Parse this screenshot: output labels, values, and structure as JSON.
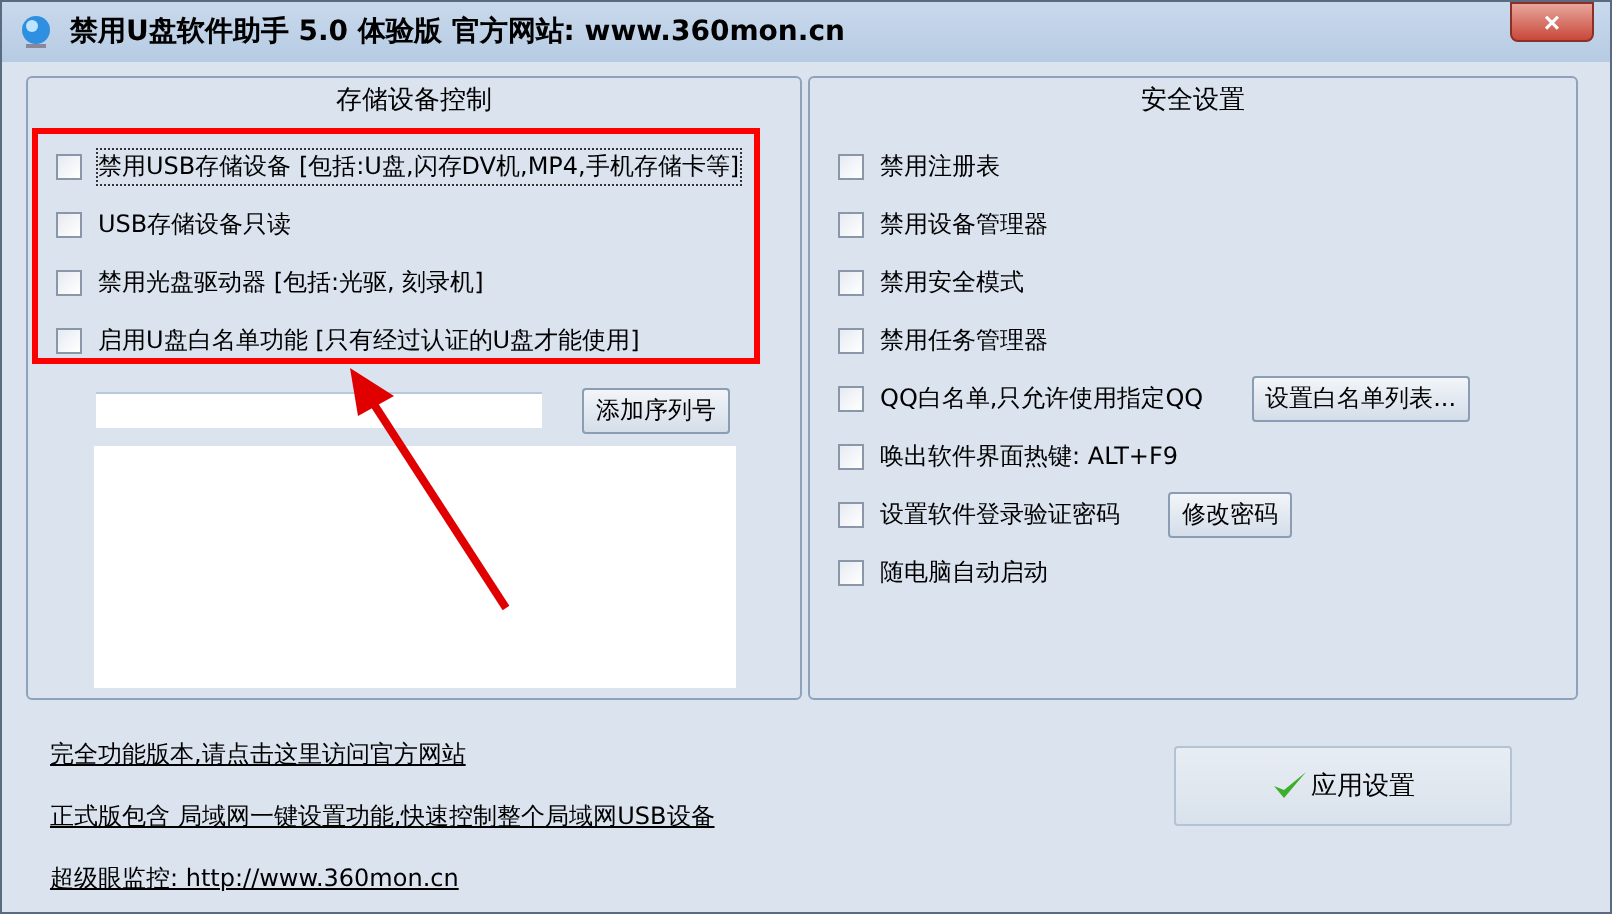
{
  "window": {
    "title": "禁用U盘软件助手 5.0 体验版  官方网站: www.360mon.cn",
    "close": "×"
  },
  "storage_panel": {
    "title": "存储设备控制",
    "options": [
      {
        "label": "禁用USB存储设备 [包括:U盘,闪存DV机,MP4,手机存储卡等]",
        "checked": false,
        "focused": true
      },
      {
        "label": "USB存储设备只读",
        "checked": false,
        "focused": false
      },
      {
        "label": "禁用光盘驱动器 [包括:光驱, 刻录机]",
        "checked": false,
        "focused": false
      },
      {
        "label": "启用U盘白名单功能 [只有经过认证的U盘才能使用]",
        "checked": false,
        "focused": false
      }
    ],
    "add_button": "添加序列号"
  },
  "security_panel": {
    "title": "安全设置",
    "options": [
      {
        "label": "禁用注册表",
        "checked": false
      },
      {
        "label": "禁用设备管理器",
        "checked": false
      },
      {
        "label": "禁用安全模式",
        "checked": false
      },
      {
        "label": "禁用任务管理器",
        "checked": false
      },
      {
        "label": "QQ白名单,只允许使用指定QQ",
        "checked": false,
        "button": "设置白名单列表..."
      },
      {
        "label": "唤出软件界面热键: ALT+F9",
        "checked": false
      },
      {
        "label": "设置软件登录验证密码",
        "checked": false,
        "button": "修改密码"
      },
      {
        "label": "随电脑自动启动",
        "checked": false
      }
    ]
  },
  "links": [
    "完全功能版本,请点击这里访问官方网站",
    "正式版包含 局域网一键设置功能,快速控制整个局域网USB设备",
    "超级眼监控: http://www.360mon.cn"
  ],
  "apply_button": "应用设置"
}
